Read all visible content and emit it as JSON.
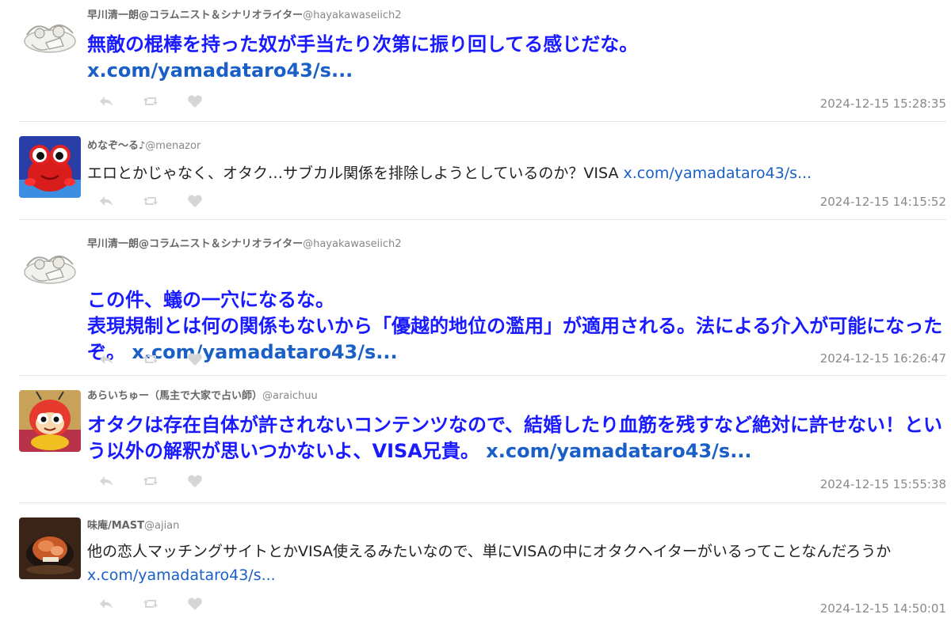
{
  "colors": {
    "accent_text": "#1a1aff",
    "link": "#1a5fc8",
    "meta": "#8a8a8a",
    "icon": "#d6d6d6"
  },
  "tweets": [
    {
      "author_name": "早川清一朗@コラムニスト＆シナリオライター",
      "handle": "@hayakawaseiich2",
      "avatar_icon": "sketch-avatar-icon",
      "text": "無敵の棍棒を持った奴が手当たり次第に振り回してる感じだな。",
      "link": "x.com/yamadataro43/s...",
      "timestamp": "2024-12-15 15:28:35"
    },
    {
      "author_name": "めなぞ〜る♪",
      "handle": "@menazor",
      "avatar_icon": "red-creature-avatar-icon",
      "text": "エロとかじゃなく、オタク…サブカル関係を排除しようとしているのか？VISA ",
      "link": "x.com/yamadataro43/s...",
      "timestamp": "2024-12-15 14:15:52"
    },
    {
      "author_name": "早川清一朗@コラムニスト＆シナリオライター",
      "handle": "@hayakawaseiich2",
      "avatar_icon": "sketch-avatar-icon",
      "text": "この件、蟻の一穴になるな。\n表現規制とは何の関係もないから「優越的地位の濫用」が適用される。法による介入が可能になったぞ。 ",
      "link": "x.com/yamadataro43/s...",
      "timestamp": "2024-12-15 16:26:47"
    },
    {
      "author_name": "あらいちゅー（馬主で大家で占い師）",
      "handle": "@araichuu",
      "avatar_icon": "bee-mascot-avatar-icon",
      "text": "オタクは存在自体が許されないコンテンツなので、結婚したり血筋を残すなど絶対に許せない！という以外の解釈が思いつかないよ、VISA兄貴。 ",
      "link": "x.com/yamadataro43/s...",
      "timestamp": "2024-12-15 15:55:38"
    },
    {
      "author_name": "味庵/MAST",
      "handle": "@ajian",
      "avatar_icon": "food-avatar-icon",
      "text": "他の恋人マッチングサイトとかVISA使えるみたいなので、単にVISAの中にオタクヘイターがいるってことなんだろうか ",
      "link": "x.com/yamadataro43/s...",
      "timestamp": "2024-12-15 14:50:01"
    }
  ]
}
